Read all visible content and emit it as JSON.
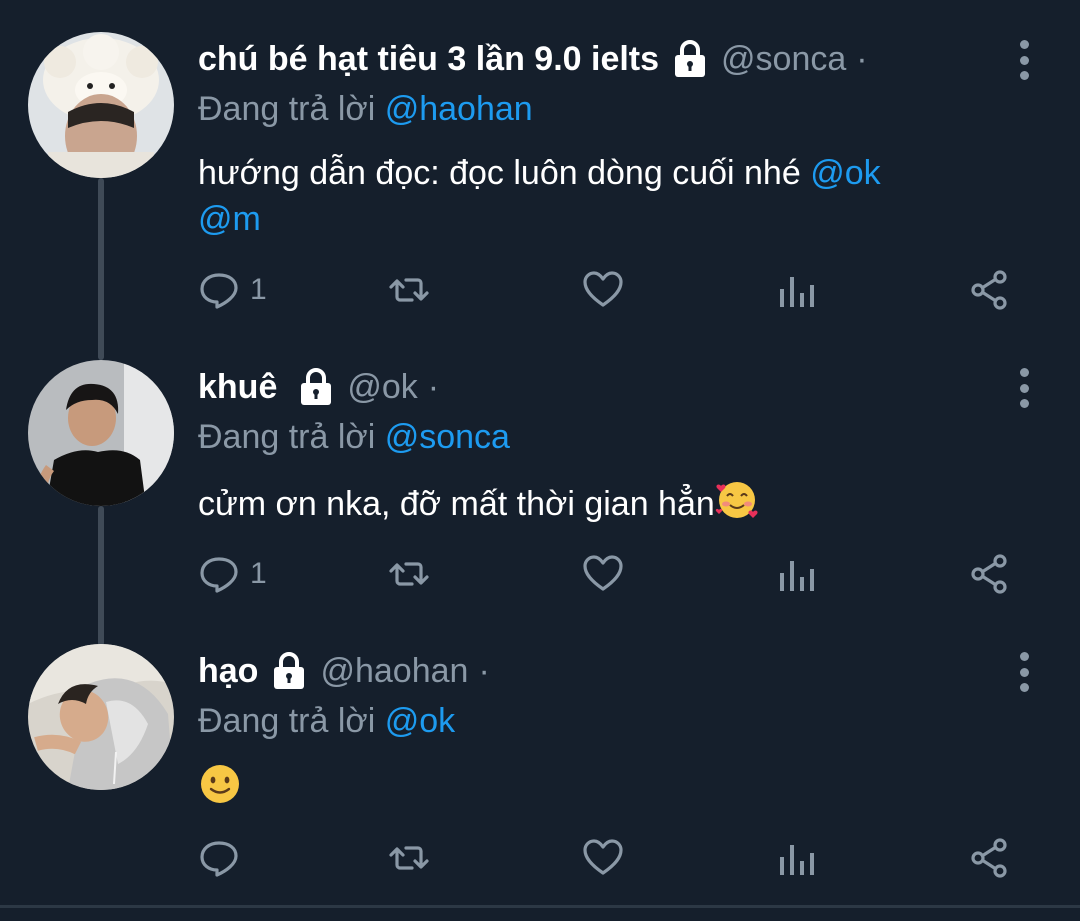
{
  "tweets": [
    {
      "display_name": "chú bé hạt tiêu 3 lần 9.0 ielts",
      "handle": "@sonca",
      "separator": "·",
      "replying_prefix": "Đang trả lời",
      "replying_to": "@haohan",
      "text": "hướng dẫn đọc: đọc luôn dòng cuối nhé",
      "mentions": [
        "@ok",
        "@m"
      ],
      "reply_count": "1",
      "avatar_icon": "avatar-sheep-hat"
    },
    {
      "display_name": "khuê",
      "handle": "@ok",
      "separator": "·",
      "replying_prefix": "Đang trả lời",
      "replying_to": "@sonca",
      "text": "cửm ơn nka, đỡ mất thời gian hẳn",
      "emoji": "smiling-face-with-hearts",
      "reply_count": "1",
      "avatar_icon": "avatar-dark-shirt"
    },
    {
      "display_name": "hạo",
      "handle": "@haohan",
      "separator": "·",
      "replying_prefix": "Đang trả lời",
      "replying_to": "@ok",
      "emoji": "slightly-smiling-face",
      "reply_count": "",
      "avatar_icon": "avatar-grey-hoodie"
    }
  ],
  "colors": {
    "background": "#151f2c",
    "mention": "#1d9bf0",
    "muted": "#8a98a6",
    "thread_line": "#3f4a57"
  },
  "icons": [
    "reply-icon",
    "retweet-icon",
    "like-icon",
    "analytics-icon",
    "share-icon",
    "lock-icon",
    "more-icon"
  ]
}
